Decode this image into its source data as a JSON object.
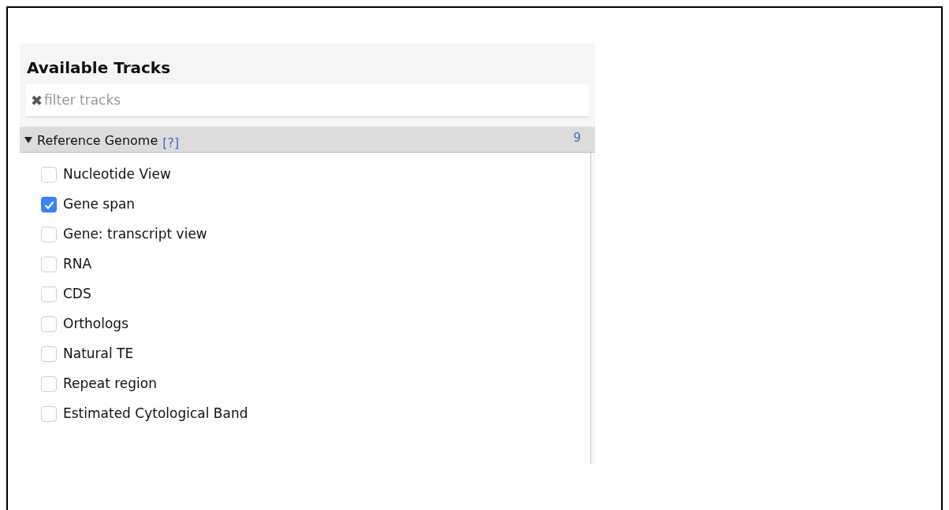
{
  "panel": {
    "title": "Available Tracks",
    "filter": {
      "icon": "✖",
      "placeholder": "filter tracks"
    },
    "category": {
      "name": "Reference Genome",
      "help": "[?]",
      "count": "9",
      "expanded": true,
      "tracks": [
        {
          "label": "Nucleotide View",
          "checked": false
        },
        {
          "label": "Gene span",
          "checked": true
        },
        {
          "label": "Gene: transcript view",
          "checked": false
        },
        {
          "label": "RNA",
          "checked": false
        },
        {
          "label": "CDS",
          "checked": false
        },
        {
          "label": "Orthologs",
          "checked": false
        },
        {
          "label": "Natural TE",
          "checked": false
        },
        {
          "label": "Repeat region",
          "checked": false
        },
        {
          "label": "Estimated Cytological Band",
          "checked": false
        }
      ]
    }
  }
}
